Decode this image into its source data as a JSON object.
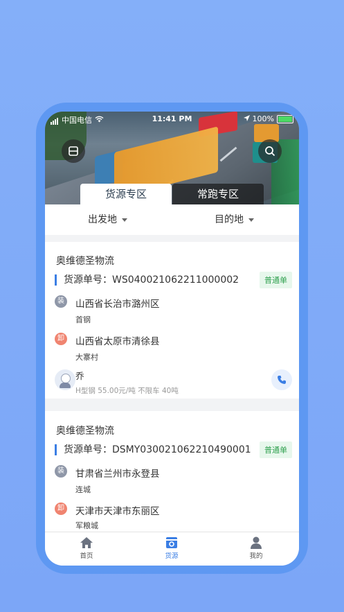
{
  "status_bar": {
    "carrier": "中国电信",
    "time": "11:41 PM",
    "battery": "100%"
  },
  "tabs": [
    {
      "label": "货源专区"
    },
    {
      "label": "常跑专区"
    }
  ],
  "filters": {
    "origin": "出发地",
    "destination": "目的地"
  },
  "cards": [
    {
      "company": "奥维德圣物流",
      "order_label": "货源单号：",
      "order_no": "WS040021062211000002",
      "badge": "普通单",
      "load_tag": "装",
      "load_addr": "山西省长治市潞州区",
      "load_sub": "首钢",
      "unload_tag": "卸",
      "unload_addr": "山西省太原市清徐县",
      "unload_sub": "大寨村",
      "contact": "乔",
      "detail": "H型钢 55.00元/吨 不限车 40吨"
    },
    {
      "company": "奥维德圣物流",
      "order_label": "货源单号：",
      "order_no": "DSMY030021062210490001",
      "badge": "普通单",
      "load_tag": "装",
      "load_addr": "甘肃省兰州市永登县",
      "load_sub": "连城",
      "unload_tag": "卸",
      "unload_addr": "天津市天津市东丽区",
      "unload_sub": "军粮城"
    }
  ],
  "nav": [
    {
      "label": "首页",
      "icon": "home-icon"
    },
    {
      "label": "货源",
      "icon": "cargo-icon"
    },
    {
      "label": "我的",
      "icon": "user-icon"
    }
  ],
  "colors": {
    "accent": "#3b7ee4",
    "background": "#84aff9",
    "badge_green": "#31a150"
  }
}
